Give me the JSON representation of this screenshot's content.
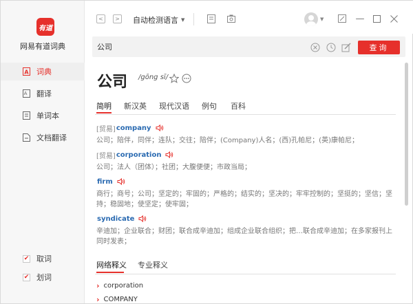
{
  "sidebar": {
    "logo_text": "有道",
    "app_name": "网易有道词典",
    "items": [
      {
        "label": "词典",
        "icon": "dictionary-icon",
        "active": true
      },
      {
        "label": "翻译",
        "icon": "translate-icon",
        "active": false
      },
      {
        "label": "单词本",
        "icon": "wordbook-icon",
        "active": false
      },
      {
        "label": "文档翻译",
        "icon": "document-icon",
        "active": false
      }
    ],
    "options": [
      {
        "label": "取词",
        "checked": true
      },
      {
        "label": "划词",
        "checked": true
      }
    ]
  },
  "topbar": {
    "language": "自动检测语言"
  },
  "search": {
    "value": "公司",
    "button_label": "查询"
  },
  "word": {
    "headword": "公司",
    "phonetic": "/gōng sī/"
  },
  "tabs": [
    "简明",
    "新汉英",
    "现代汉语",
    "例句",
    "百科"
  ],
  "entries": [
    {
      "tag": "[贸易]",
      "word": "company",
      "desc": "公司；陪伴，同伴；连队；交往；陪伴；(Company)人名；(西)孔帕尼；(英)康帕尼；"
    },
    {
      "tag": "[贸易]",
      "word": "corporation",
      "desc": "公司；法人（团体）；社团；大腹便便；市政当局；"
    },
    {
      "tag": "",
      "word": "firm",
      "desc": "商行；商号；公司；坚定的；牢固的；严格的；结实的；坚决的；牢牢控制的；坚挺的；坚信；坚持；稳固地；使坚定；使牢固；"
    },
    {
      "tag": "",
      "word": "syndicate",
      "desc": "辛迪加；企业联合；财团；联合成辛迪加；组成企业联合组织；把…联合成辛迪加；在多家报刊上同时发表；"
    }
  ],
  "section_tabs": [
    "网络释义",
    "专业释义"
  ],
  "web_items": [
    "corporation",
    "COMPANY"
  ],
  "colors": {
    "accent": "#e6302b",
    "link": "#2a6ab1"
  }
}
